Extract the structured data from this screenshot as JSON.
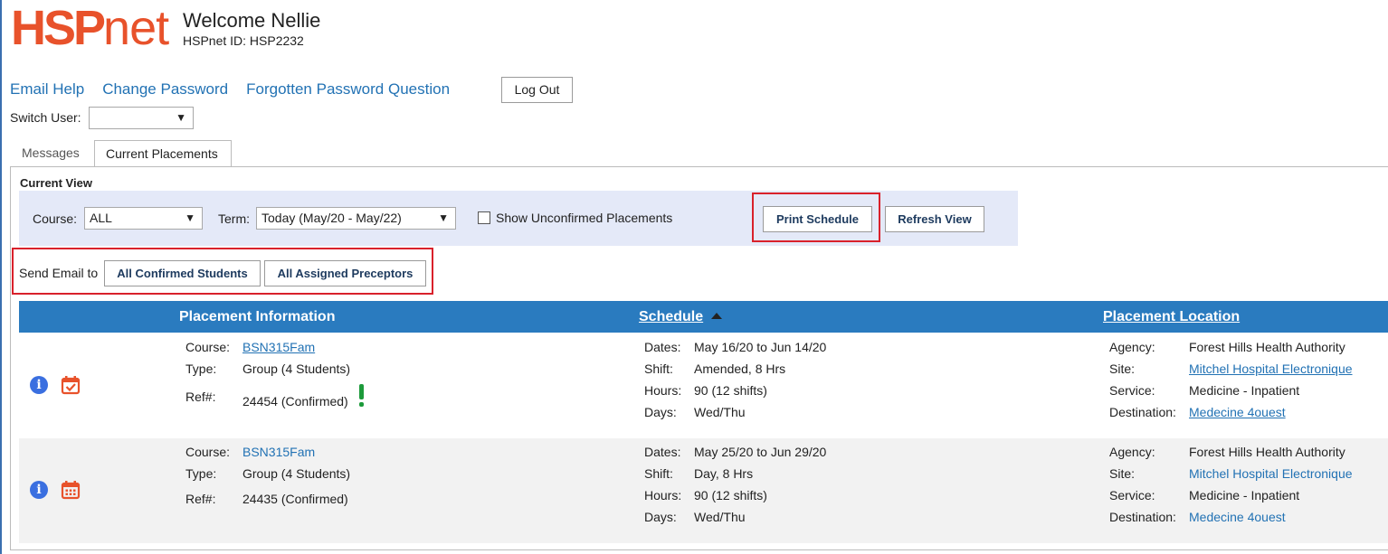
{
  "header": {
    "logo_bold": "HSP",
    "logo_light": "net",
    "welcome": "Welcome Nellie",
    "hspnet_id": "HSPnet ID: HSP2232"
  },
  "toplinks": {
    "email_help": "Email Help",
    "change_password": "Change Password",
    "forgotten_password": "Forgotten Password Question",
    "logout": "Log Out"
  },
  "switch_user": {
    "label": "Switch User:",
    "value": ""
  },
  "tabs": [
    {
      "label": "Messages",
      "active": false
    },
    {
      "label": "Current Placements",
      "active": true
    }
  ],
  "current_view": {
    "title": "Current View",
    "course_label": "Course:",
    "course_value": "ALL",
    "term_label": "Term:",
    "term_value": "Today (May/20 - May/22)",
    "show_unconfirmed_label": "Show Unconfirmed Placements",
    "show_unconfirmed_checked": false,
    "print_schedule": "Print Schedule",
    "refresh_view": "Refresh View"
  },
  "send_email": {
    "label": "Send Email to",
    "all_students": "All Confirmed Students",
    "all_preceptors": "All Assigned Preceptors"
  },
  "table": {
    "col_placement": "Placement Information",
    "col_schedule": "Schedule",
    "col_location": "Placement Location",
    "rows": [
      {
        "course_label": "Course:",
        "course": "BSN315Fam",
        "type_label": "Type:",
        "type": "Group (4 Students)",
        "ref_label": "Ref#:",
        "ref": "24454 (Confirmed)",
        "dates_label": "Dates:",
        "dates": "May 16/20 to Jun 14/20",
        "shift_label": "Shift:",
        "shift": "Amended, 8 Hrs",
        "hours_label": "Hours:",
        "hours": "90 (12 shifts)",
        "days_label": "Days:",
        "days": "Wed/Thu",
        "agency_label": "Agency:",
        "agency": "Forest Hills Health Authority",
        "site_label": "Site:",
        "site": "Mitchel Hospital Electronique",
        "service_label": "Service:",
        "service": "Medicine - Inpatient",
        "destination_label": "Destination:",
        "destination": "Medecine 4ouest"
      },
      {
        "course_label": "Course:",
        "course": "BSN315Fam",
        "type_label": "Type:",
        "type": "Group (4 Students)",
        "ref_label": "Ref#:",
        "ref": "24435 (Confirmed)",
        "dates_label": "Dates:",
        "dates": "May 25/20 to Jun 29/20",
        "shift_label": "Shift:",
        "shift": "Day, 8 Hrs",
        "hours_label": "Hours:",
        "hours": "90 (12 shifts)",
        "days_label": "Days:",
        "days": "Wed/Thu",
        "agency_label": "Agency:",
        "agency": "Forest Hills Health Authority",
        "site_label": "Site:",
        "site": "Mitchel Hospital Electronique",
        "service_label": "Service:",
        "service": "Medicine - Inpatient",
        "destination_label": "Destination:",
        "destination": "Medecine 4ouest"
      }
    ]
  },
  "colors": {
    "brand": "#e8522b",
    "link": "#2272b4",
    "table_header": "#2a7bbf",
    "filter_bg": "#e4e9f8",
    "highlight": "#d9212b",
    "status_ok": "#1c9a3a"
  },
  "icons": {
    "info": "info-icon",
    "calendar_checked": "calendar-check-icon",
    "calendar": "calendar-icon",
    "exclamation": "exclamation-icon",
    "sort": "sort-ascending-icon",
    "dropdown": "chevron-down-icon"
  }
}
